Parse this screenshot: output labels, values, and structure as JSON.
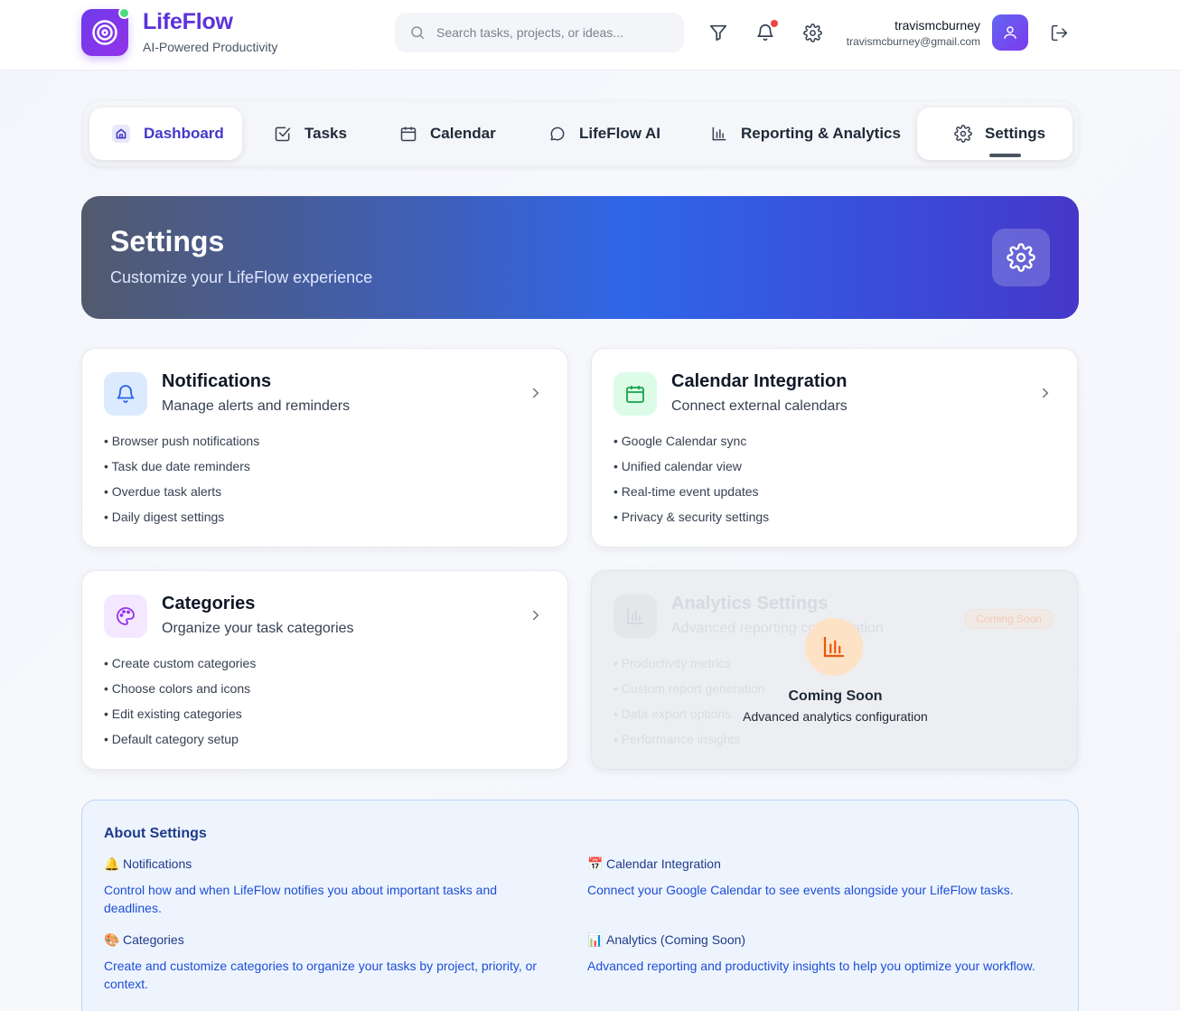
{
  "header": {
    "brand": "LifeFlow",
    "tagline": "AI-Powered Productivity",
    "search_placeholder": "Search tasks, projects, or ideas...",
    "user_name": "travismcburney",
    "user_email": "travismcburney@gmail.com",
    "icons": [
      "filter-icon",
      "bell-icon",
      "gear-icon",
      "user-icon",
      "logout-icon"
    ]
  },
  "nav": {
    "items": [
      {
        "label": "Dashboard",
        "icon": "home-icon"
      },
      {
        "label": "Tasks",
        "icon": "check-square-icon"
      },
      {
        "label": "Calendar",
        "icon": "calendar-icon"
      },
      {
        "label": "LifeFlow AI",
        "icon": "chat-icon"
      },
      {
        "label": "Reporting & Analytics",
        "icon": "bar-chart-icon"
      },
      {
        "label": "Settings",
        "icon": "gear-icon"
      }
    ]
  },
  "hero": {
    "title": "Settings",
    "subtitle": "Customize your LifeFlow experience"
  },
  "cards": [
    {
      "title": "Notifications",
      "subtitle": "Manage alerts and reminders",
      "items": [
        "Browser push notifications",
        "Task due date reminders",
        "Overdue task alerts",
        "Daily digest settings"
      ]
    },
    {
      "title": "Calendar Integration",
      "subtitle": "Connect external calendars",
      "items": [
        "Google Calendar sync",
        "Unified calendar view",
        "Real-time event updates",
        "Privacy & security settings"
      ]
    },
    {
      "title": "Categories",
      "subtitle": "Organize your task categories",
      "items": [
        "Create custom categories",
        "Choose colors and icons",
        "Edit existing categories",
        "Default category setup"
      ]
    },
    {
      "title": "Analytics Settings",
      "subtitle": "Advanced reporting configuration",
      "badge": "Coming Soon",
      "items": [
        "Productivity metrics",
        "Custom report generation",
        "Data export options",
        "Performance insights"
      ],
      "overlay_title": "Coming Soon",
      "overlay_subtitle": "Advanced analytics configuration"
    }
  ],
  "about": {
    "title": "About Settings",
    "sections": [
      {
        "emoji": "🔔",
        "heading": "Notifications",
        "text": "Control how and when LifeFlow notifies you about important tasks and deadlines."
      },
      {
        "emoji": "📅",
        "heading": "Calendar Integration",
        "text": "Connect your Google Calendar to see events alongside your LifeFlow tasks."
      },
      {
        "emoji": "🎨",
        "heading": "Categories",
        "text": "Create and customize categories to organize your tasks by project, priority, or context."
      },
      {
        "emoji": "📊",
        "heading": "Analytics (Coming Soon)",
        "text": "Advanced reporting and productivity insights to help you optimize your workflow."
      }
    ]
  },
  "colors": {
    "brand": "#5b32d9",
    "accent": "#2f66e8",
    "notification_dot": "#ef4444"
  }
}
